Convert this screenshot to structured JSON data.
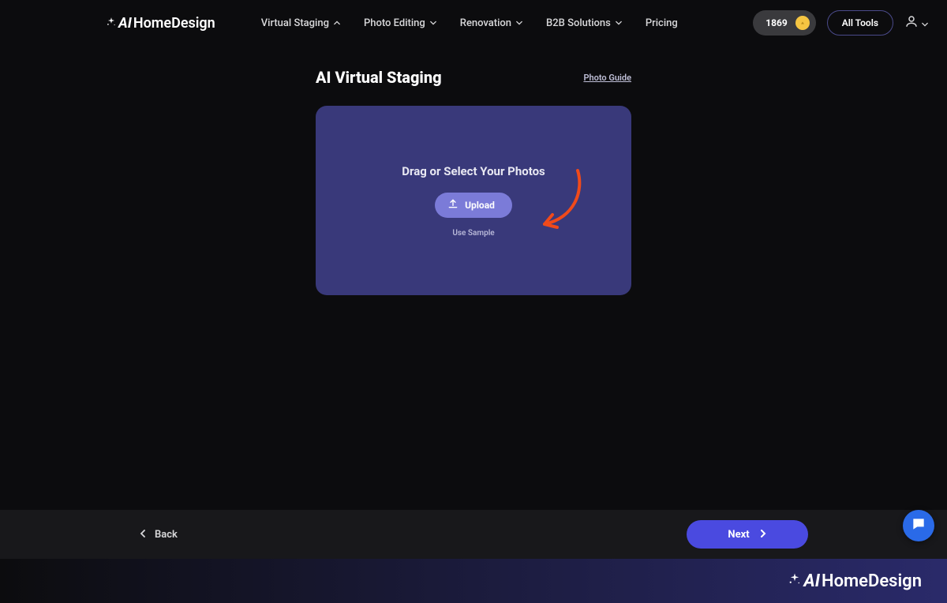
{
  "header": {
    "logo_text_1": "AI",
    "logo_text_2": "HomeDesign",
    "nav": [
      {
        "label": "Virtual Staging",
        "expanded": true
      },
      {
        "label": "Photo Editing",
        "expanded": false
      },
      {
        "label": "Renovation",
        "expanded": false
      },
      {
        "label": "B2B Solutions",
        "expanded": false
      },
      {
        "label": "Pricing",
        "no_chevron": true
      }
    ],
    "credits": "1869",
    "all_tools_label": "All Tools"
  },
  "main": {
    "title": "AI Virtual Staging",
    "photo_guide_label": "Photo Guide",
    "upload_heading": "Drag or Select Your Photos",
    "upload_button_label": "Upload",
    "use_sample_label": "Use Sample"
  },
  "footer": {
    "back_label": "Back",
    "next_label": "Next"
  },
  "brand": {
    "logo_text_1": "AI",
    "logo_text_2": "HomeDesign"
  }
}
